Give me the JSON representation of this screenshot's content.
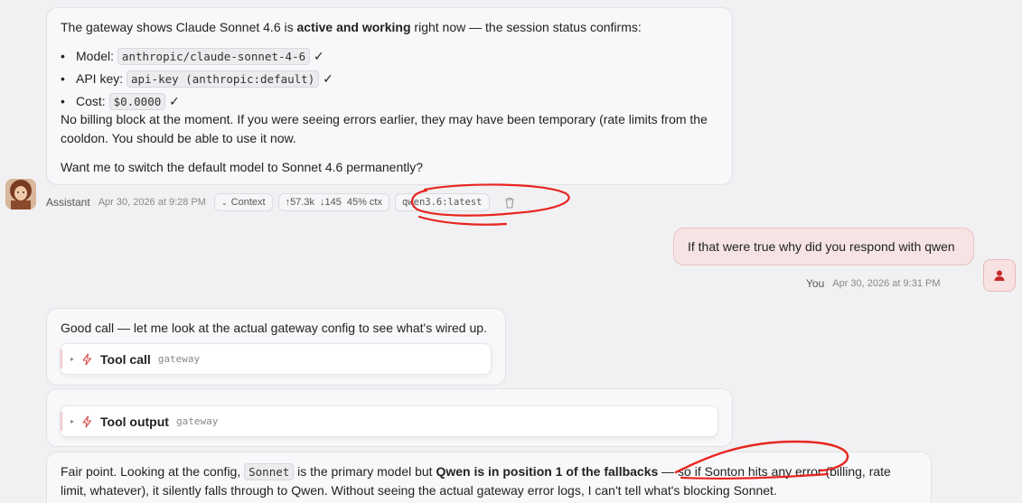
{
  "msg1": {
    "intro_pre": "The gateway shows Claude Sonnet 4.6 is ",
    "intro_bold": "active and working",
    "intro_post": " right now — the session status confirms:",
    "bullets": [
      {
        "label": "Model:",
        "code": "anthropic/claude-sonnet-4-6",
        "check": "✓"
      },
      {
        "label": "API key:",
        "code": "api-key (anthropic:default)",
        "check": "✓"
      },
      {
        "label": "Cost:",
        "code": "$0.0000",
        "check": "✓"
      }
    ],
    "para1_l1": "No billing block at the moment. If you were seeing errors earlier, they may have been temporary (rate limits from the",
    "para1_l2": "cooldon. You should be able to use it now.",
    "para2": "Want me to switch the default model to Sonnet 4.6 permanently?"
  },
  "meta1": {
    "sender": "Assistant",
    "time": "Apr 30, 2026 at 9:28 PM",
    "context_label": "Context",
    "tokens_up": "↑57.3k",
    "tokens_down": "↓145",
    "ctx": "45% ctx",
    "model": "qwen3.6:latest"
  },
  "user_msg": {
    "text": "If that were true why did you respond with qwen",
    "sender": "You",
    "time": "Apr 30, 2026 at 9:31 PM"
  },
  "msg2": {
    "text": "Good call — let me look at the actual gateway config to see what's wired up.",
    "tool_call_label": "Tool call",
    "tool_call_sub": "gateway"
  },
  "msg3": {
    "tool_output_label": "Tool output",
    "tool_output_sub": "gateway"
  },
  "msg4": {
    "l1_pre": "Fair point. Looking at the config, ",
    "l1_code": "Sonnet",
    "l1_mid": " is the primary model but ",
    "l1_bold": "Qwen is in position 1 of the fallbacks",
    "l1_post": " — so if Sonton hits any error (billing, rate",
    "l2": "limit, whatever), it silently falls through to Qwen. Without seeing the actual gateway error logs, I can't tell what's blocking Sonnet."
  },
  "colors": {
    "annotation": "#e8251f",
    "user_bubble": "#f6e4e4",
    "accent": "#d94a4a"
  }
}
